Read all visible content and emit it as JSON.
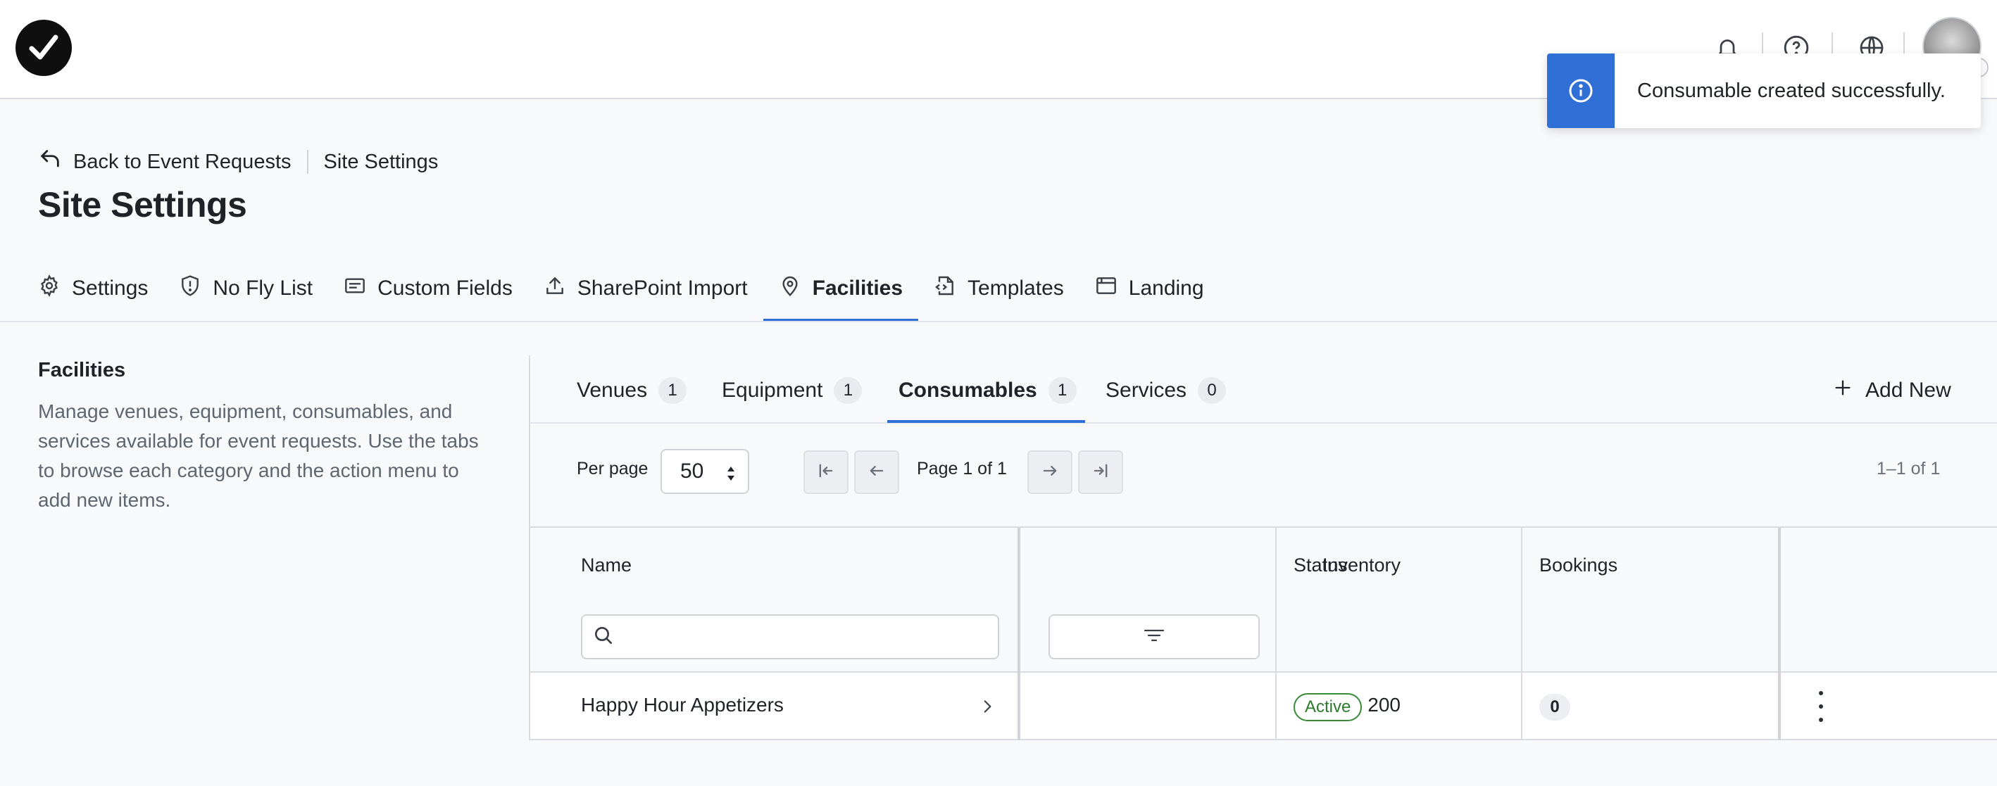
{
  "header": {
    "logo_icon": "checkmark-logo-icon",
    "icons": [
      "bell-icon",
      "help-circle-icon",
      "globe-icon"
    ],
    "avatar_icon": "user-avatar"
  },
  "toast": {
    "message": "Consumable created successfully.",
    "icon": "info-circle-icon",
    "accent": "#2f6fd6"
  },
  "breadcrumb": {
    "back_label": "Back to Event Requests",
    "current": "Site Settings"
  },
  "page_title": "Site Settings",
  "main_tabs": [
    {
      "label": "Settings",
      "icon": "gear-icon"
    },
    {
      "label": "No Fly List",
      "icon": "shield-icon"
    },
    {
      "label": "Custom Fields",
      "icon": "form-field-icon"
    },
    {
      "label": "SharePoint Import",
      "icon": "upload-icon"
    },
    {
      "label": "Facilities",
      "icon": "map-pin-icon",
      "active": true
    },
    {
      "label": "Templates",
      "icon": "code-file-icon"
    },
    {
      "label": "Landing",
      "icon": "browser-window-icon"
    }
  ],
  "description": {
    "title": "Facilities",
    "body": "Manage venues, equipment, consumables, and services available for event requests. Use the tabs to browse each category and the action menu to add new items."
  },
  "sub_tabs": [
    {
      "label": "Venues",
      "count": "1"
    },
    {
      "label": "Equipment",
      "count": "1"
    },
    {
      "label": "Consumables",
      "count": "1",
      "active": true
    },
    {
      "label": "Services",
      "count": "0"
    }
  ],
  "add_new_label": "Add New",
  "pagination": {
    "per_page_label": "Per page",
    "per_page_value": "50",
    "page_text": "Page 1 of 1",
    "range_text": "1–1 of 1"
  },
  "table": {
    "columns": {
      "name": "Name",
      "inventory": "Inventory",
      "status": "Status",
      "bookings": "Bookings"
    },
    "rows": [
      {
        "name": "Happy Hour Appetizers",
        "inventory": "200",
        "status": "Active",
        "bookings": "0"
      }
    ]
  },
  "colors": {
    "accent": "#2f6fd6",
    "status_active": "#2d7a2d"
  }
}
